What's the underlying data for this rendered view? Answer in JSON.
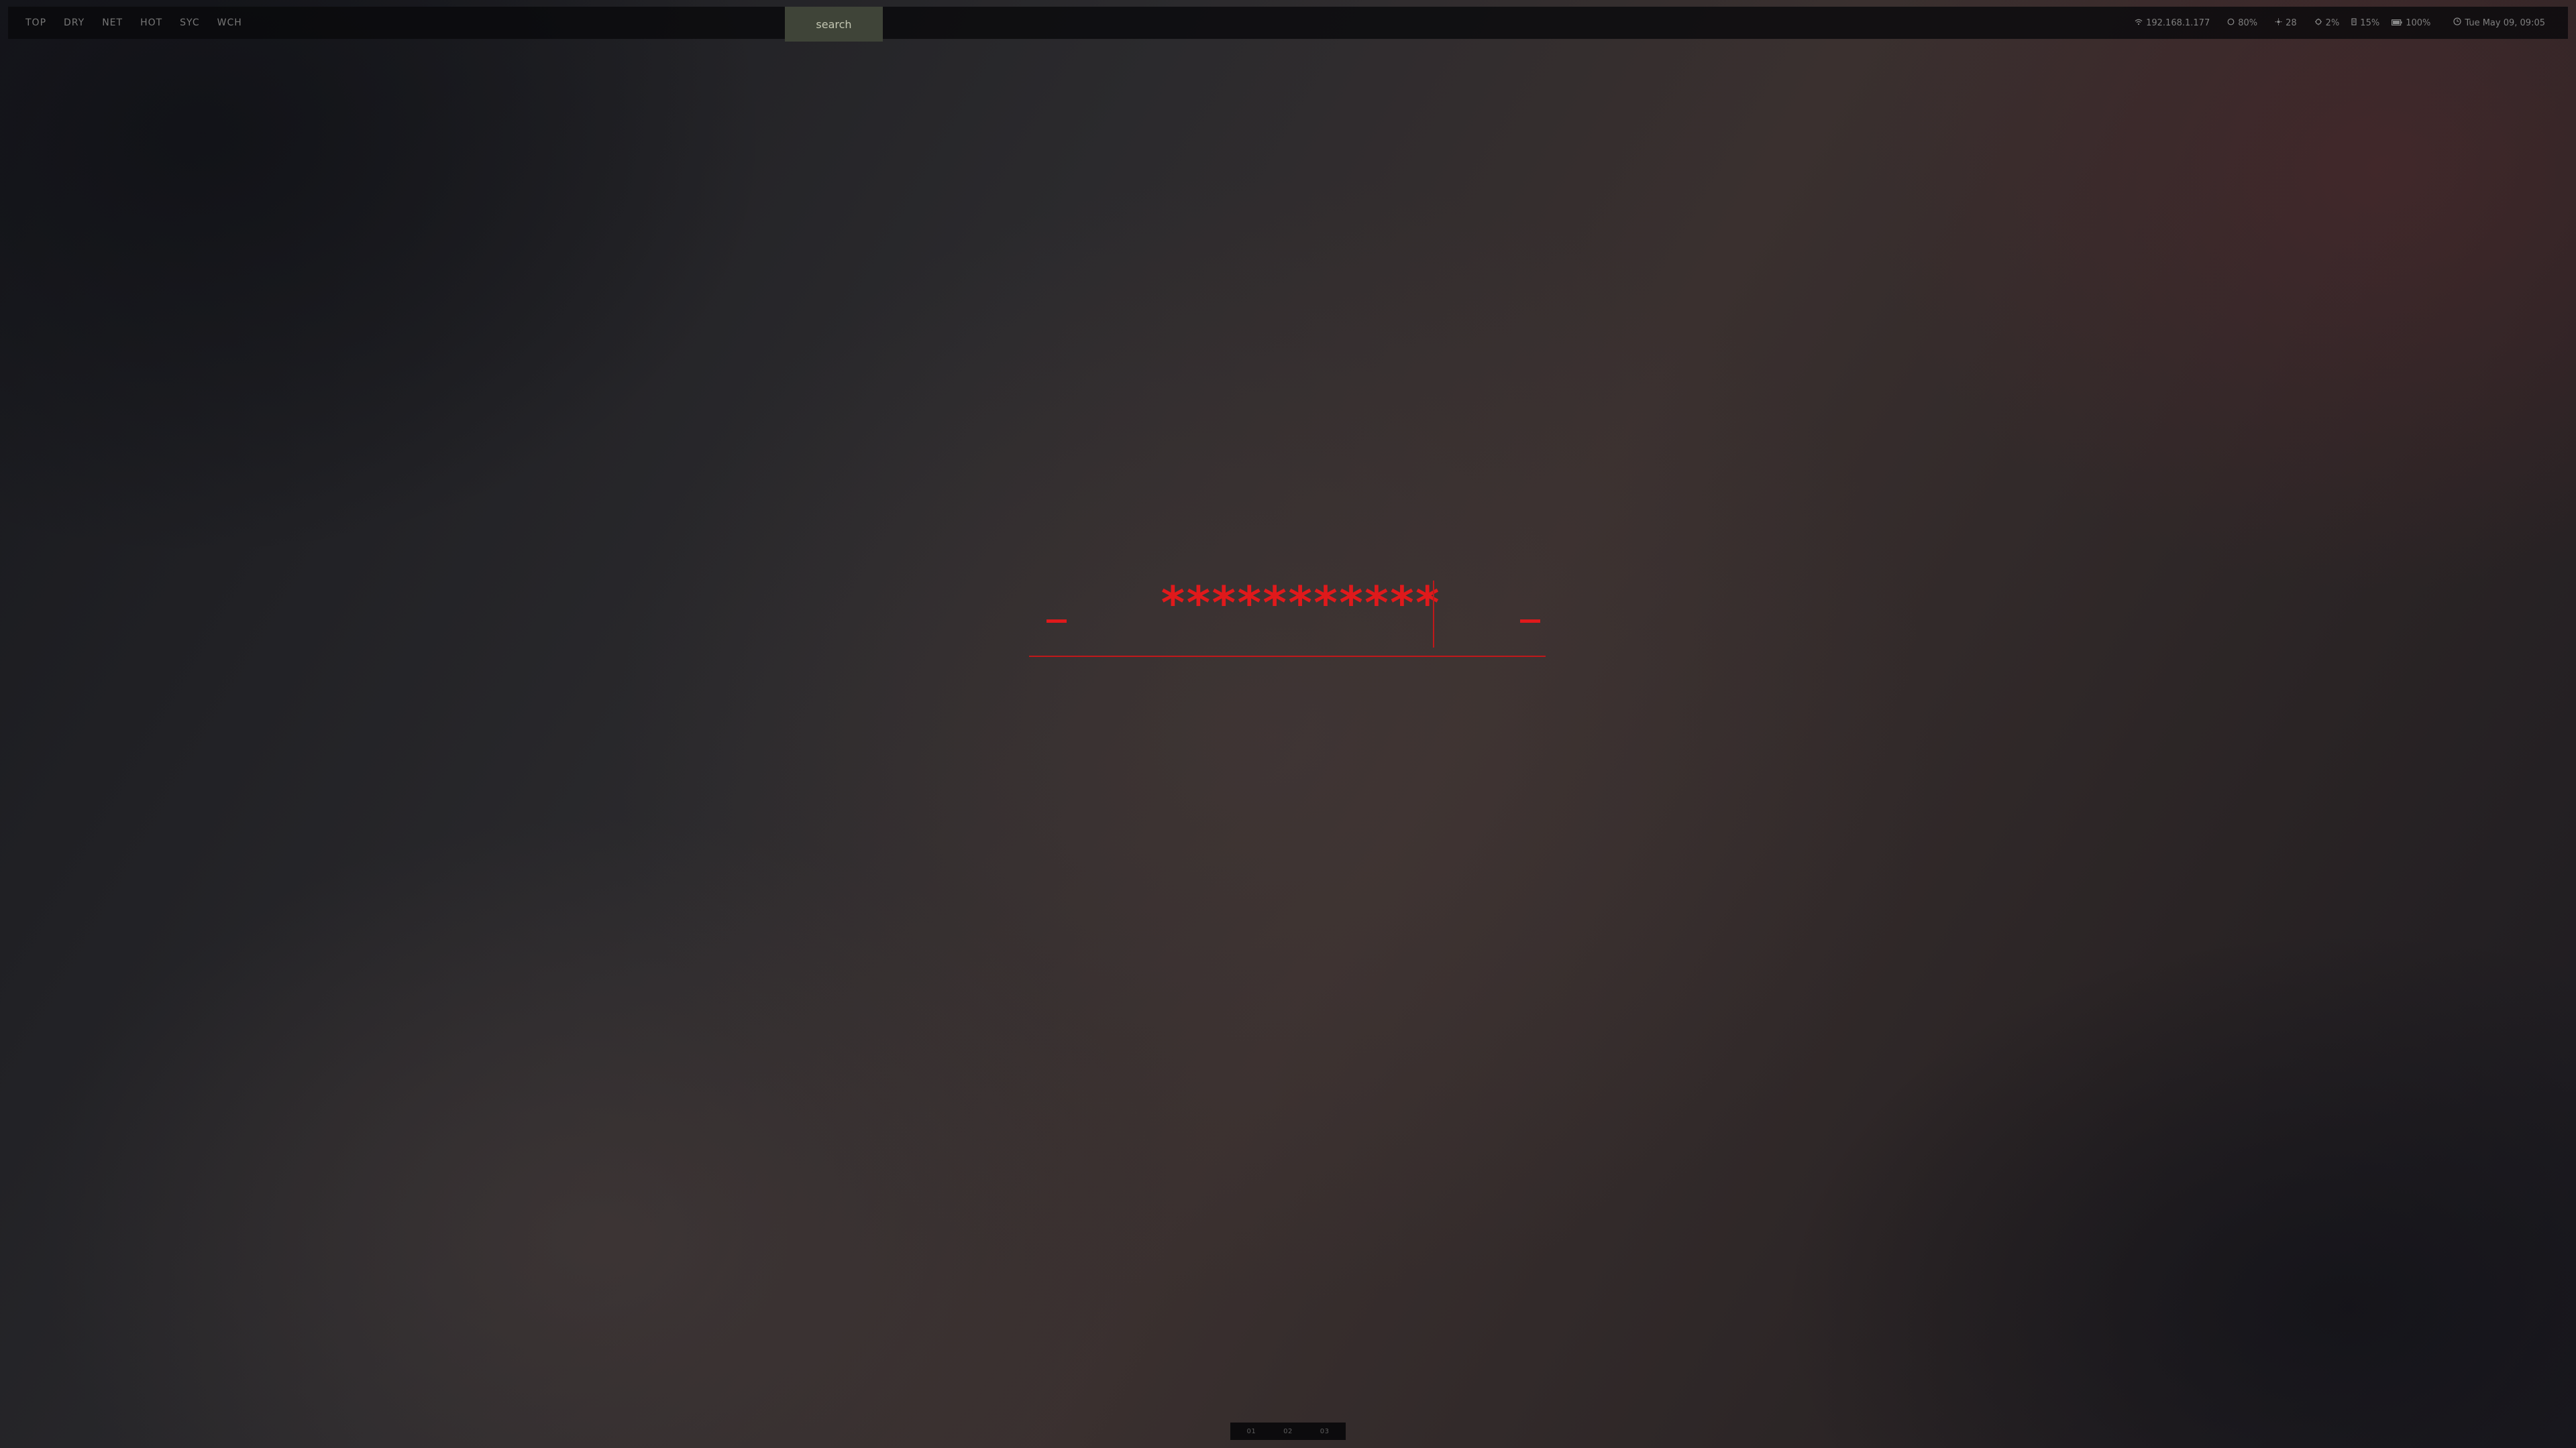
{
  "topbar": {
    "workspaces": [
      "TOP",
      "DRY",
      "NET",
      "HOT",
      "SYC",
      "WCH"
    ],
    "search": {
      "placeholder": "search"
    },
    "status": {
      "network": {
        "icon": "wifi-icon",
        "value": "192.168.1.177"
      },
      "volume": {
        "icon": "volume-icon",
        "value": "80%"
      },
      "brightness": {
        "icon": "brightness-icon",
        "value": "28"
      },
      "cpu": {
        "icon": "cpu-icon",
        "value": "2%"
      },
      "ram": {
        "icon": "memory-icon",
        "value": "15%"
      },
      "battery": {
        "icon": "battery-icon",
        "value": "100%"
      },
      "clock": {
        "icon": "clock-icon",
        "value": "Tue May 09, 09:05"
      }
    }
  },
  "lock": {
    "password_mask": "***********",
    "accent_color": "#e0191b"
  },
  "dock": {
    "items": [
      "01",
      "02",
      "03"
    ]
  },
  "colors": {
    "bar_background": "#0a0a0c",
    "search_background": "#3f4438",
    "accent": "#e0191b"
  }
}
